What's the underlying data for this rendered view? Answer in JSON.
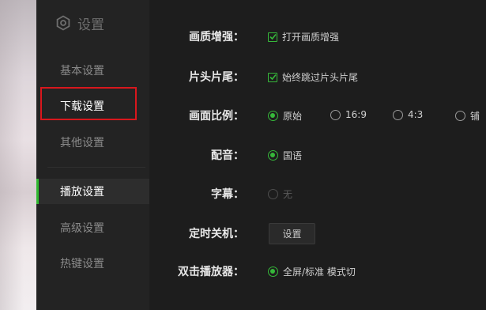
{
  "sidebar": {
    "title": "设置",
    "items": [
      {
        "label": "基本设置"
      },
      {
        "label": "下载设置"
      },
      {
        "label": "其他设置"
      },
      {
        "label": "播放设置"
      },
      {
        "label": "高级设置"
      },
      {
        "label": "热键设置"
      }
    ]
  },
  "settings": {
    "quality": {
      "label": "画质增强：",
      "option": "打开画质增强",
      "checked": true
    },
    "intro": {
      "label": "片头片尾：",
      "option": "始终跳过片头片尾",
      "checked": true
    },
    "aspect": {
      "label": "画面比例：",
      "options": [
        "原始",
        "16:9",
        "4:3",
        "铺"
      ],
      "selected": "原始"
    },
    "audio": {
      "label": "配音：",
      "options": [
        "国语"
      ],
      "selected": "国语"
    },
    "subtitle": {
      "label": "字幕：",
      "options": [
        "无"
      ],
      "enabled": false
    },
    "timer": {
      "label": "定时关机：",
      "button": "设置"
    },
    "dblclick": {
      "label": "双击播放器：",
      "options": [
        "全屏/标准 模式切"
      ],
      "selected": "全屏/标准 模式切"
    }
  },
  "colors": {
    "accent": "#36b83a",
    "highlight": "#d8171d"
  }
}
